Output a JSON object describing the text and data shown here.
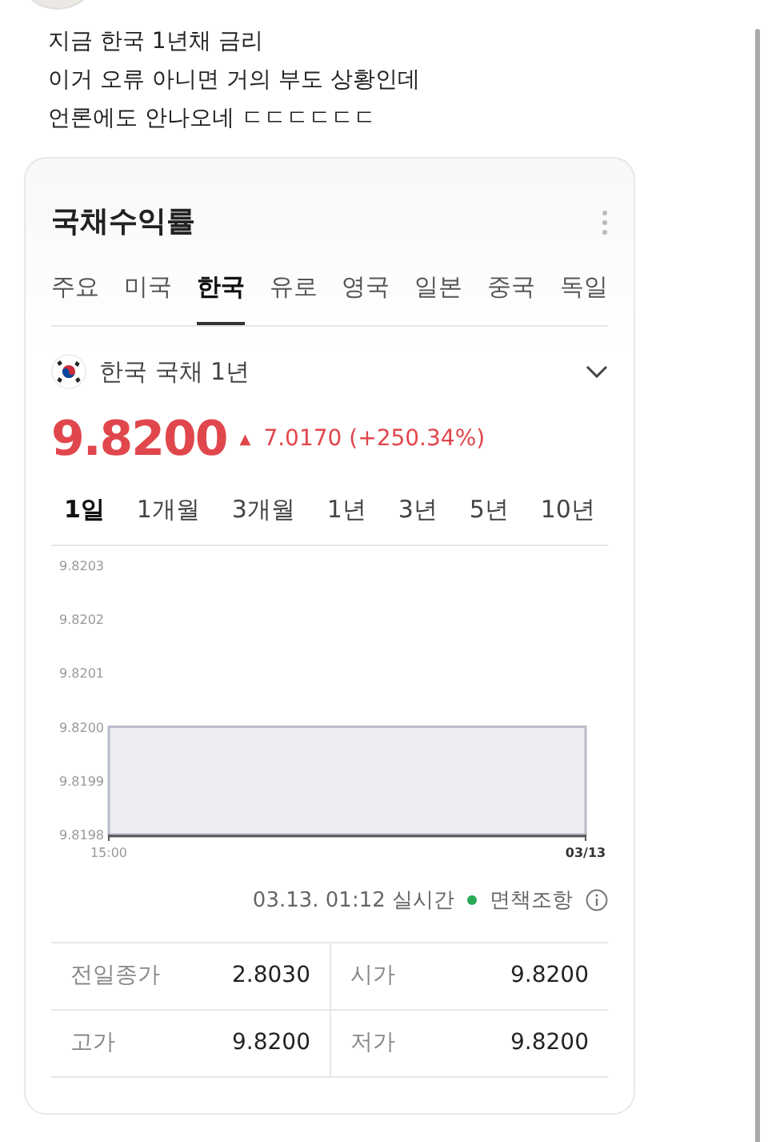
{
  "post": {
    "lines": [
      "지금 한국 1년채 금리",
      "이거 오류 아니면 거의 부도 상황인데",
      "언론에도 안나오네 ㄷㄷㄷㄷㄷㄷ"
    ]
  },
  "card": {
    "title": "국채수익률",
    "tabs": [
      {
        "label": "주요",
        "selected": false
      },
      {
        "label": "미국",
        "selected": false
      },
      {
        "label": "한국",
        "selected": true
      },
      {
        "label": "유로",
        "selected": false
      },
      {
        "label": "영국",
        "selected": false
      },
      {
        "label": "일본",
        "selected": false
      },
      {
        "label": "중국",
        "selected": false
      },
      {
        "label": "독일",
        "selected": false
      }
    ],
    "instrument": "한국 국채 1년",
    "price": "9.8200",
    "change_arrow": "▲",
    "change": "7.0170 (+250.34%)",
    "ranges": [
      {
        "label": "1일",
        "selected": true
      },
      {
        "label": "1개월",
        "selected": false
      },
      {
        "label": "3개월",
        "selected": false
      },
      {
        "label": "1년",
        "selected": false
      },
      {
        "label": "3년",
        "selected": false
      },
      {
        "label": "5년",
        "selected": false
      },
      {
        "label": "10년",
        "selected": false
      }
    ],
    "chart_data": {
      "type": "area",
      "x": [
        "15:00",
        "03/13"
      ],
      "series": [
        {
          "color": "#b9bccb",
          "values": [
            9.82,
            9.82
          ]
        }
      ],
      "ylim": [
        9.8198,
        9.8203
      ],
      "yticks": [
        {
          "value": 9.8203,
          "label": "9.8203"
        },
        {
          "value": 9.8202,
          "label": "9.8202"
        },
        {
          "value": 9.8201,
          "label": "9.8201"
        },
        {
          "value": 9.82,
          "label": "9.8200"
        },
        {
          "value": 9.8199,
          "label": "9.8199"
        },
        {
          "value": 9.8198,
          "label": "9.8198"
        }
      ]
    },
    "timestamp": "03.13. 01:12",
    "live": "실시간",
    "live_on": true,
    "disclaimer": "면책조항",
    "stats": [
      {
        "label": "전일종가",
        "value": "2.8030"
      },
      {
        "label": "시가",
        "value": "9.8200"
      },
      {
        "label": "고가",
        "value": "9.8200"
      },
      {
        "label": "저가",
        "value": "9.8200"
      }
    ]
  }
}
